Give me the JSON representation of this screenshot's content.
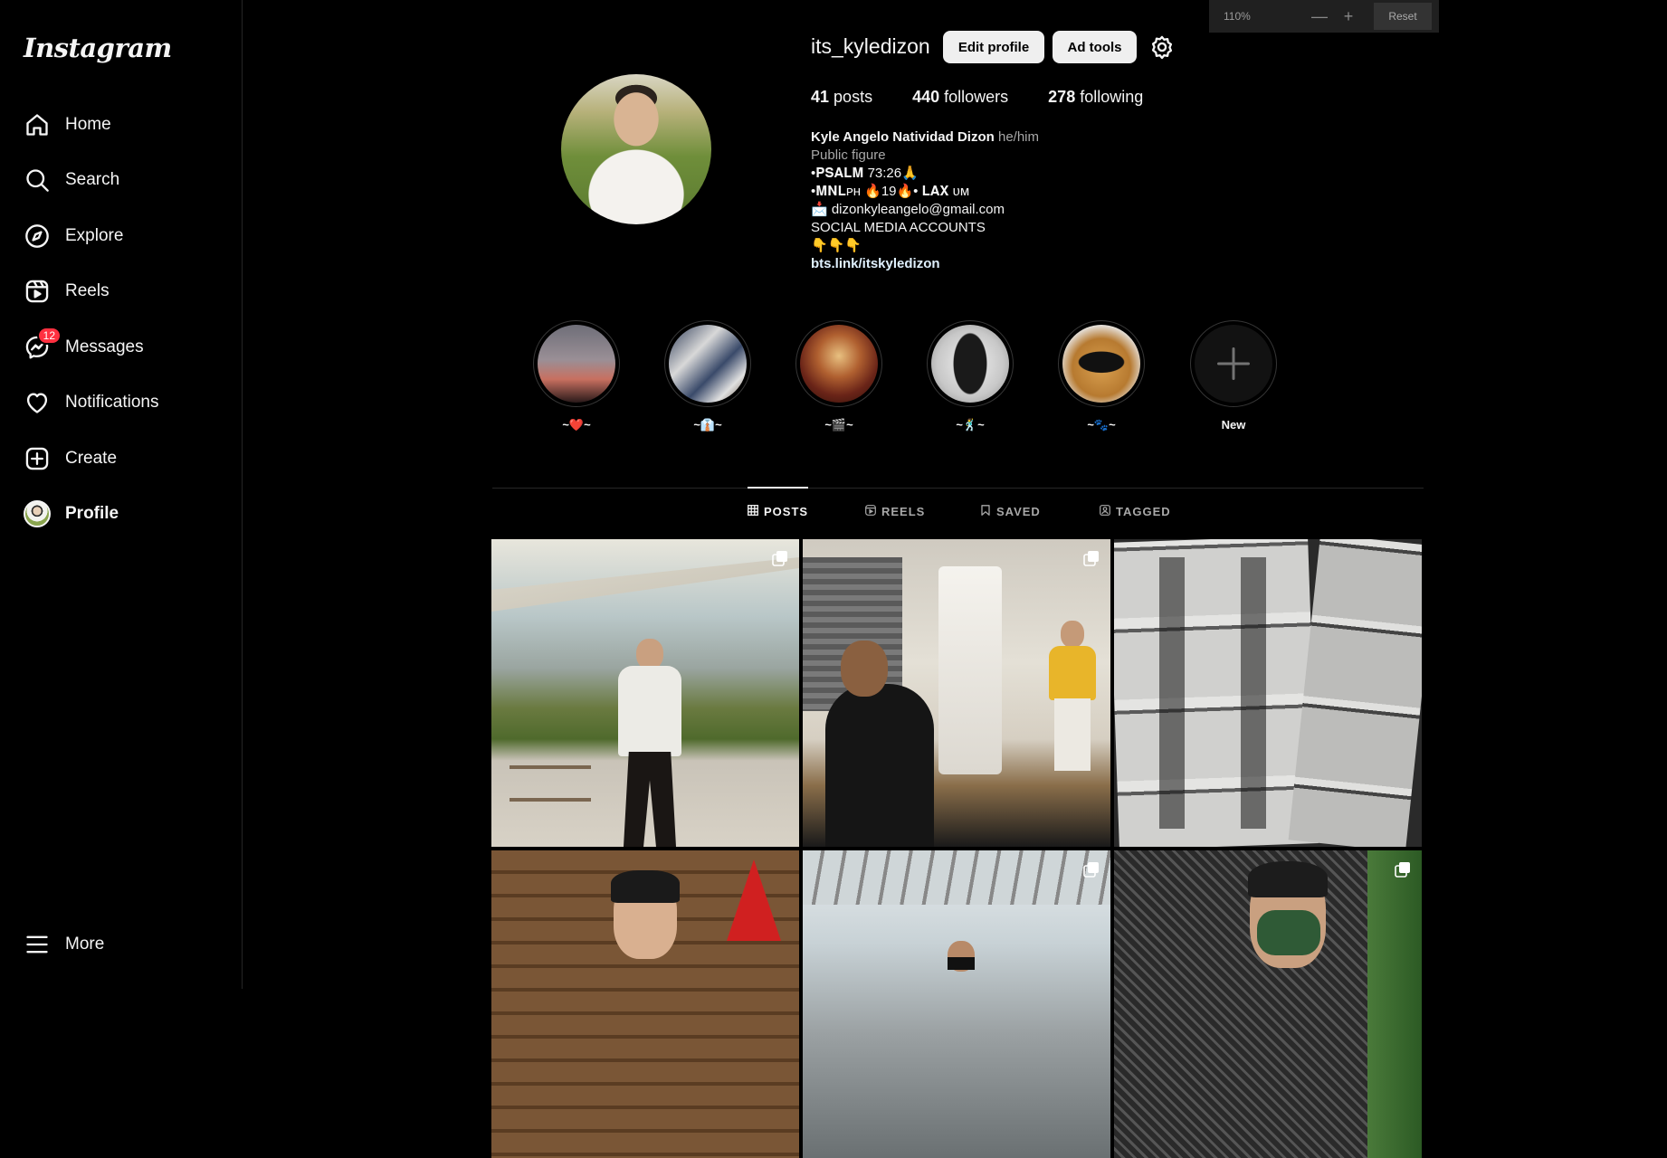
{
  "sidebar": {
    "logo": "Instagram",
    "items": [
      {
        "label": "Home",
        "icon": "home-icon"
      },
      {
        "label": "Search",
        "icon": "search-icon"
      },
      {
        "label": "Explore",
        "icon": "compass-icon"
      },
      {
        "label": "Reels",
        "icon": "reels-icon"
      },
      {
        "label": "Messages",
        "icon": "messenger-icon",
        "badge": "12"
      },
      {
        "label": "Notifications",
        "icon": "heart-icon"
      },
      {
        "label": "Create",
        "icon": "plus-square-icon"
      },
      {
        "label": "Profile",
        "icon": "avatar"
      }
    ],
    "more_label": "More"
  },
  "zoom": {
    "value": "110%",
    "minus": "—",
    "plus": "+",
    "reset": "Reset"
  },
  "profile": {
    "username": "its_kyledizon",
    "edit_label": "Edit profile",
    "adtools_label": "Ad tools",
    "stats": {
      "posts_count": "41",
      "posts_label": "posts",
      "followers_count": "440",
      "followers_label": "followers",
      "following_count": "278",
      "following_label": "following"
    },
    "bio": {
      "name": "Kyle Angelo Natividad Dizon",
      "pronouns": "he/him",
      "category": "Public figure",
      "lines": [
        "•𝐏𝐒𝐀𝐋𝐌 73:26🙏",
        "•𝐌𝐍𝐋ᴘʜ 🔥19🔥• 𝐋𝐀𝐗 ᴜᴍ",
        "📩 dizonkyleangelo@gmail.com",
        "SOCIAL MEDIA ACCOUNTS",
        "👇👇👇"
      ],
      "link": "bts.link/itskyledizon"
    }
  },
  "highlights": [
    {
      "label": "~❤️~"
    },
    {
      "label": "~👔~"
    },
    {
      "label": "~🎬~"
    },
    {
      "label": "~🕺~"
    },
    {
      "label": "~🐾~"
    },
    {
      "label": "New"
    }
  ],
  "tabs": [
    {
      "label": "POSTS",
      "icon": "grid-icon",
      "active": true
    },
    {
      "label": "REELS",
      "icon": "reels-icon",
      "active": false
    },
    {
      "label": "SAVED",
      "icon": "bookmark-icon",
      "active": false
    },
    {
      "label": "TAGGED",
      "icon": "tag-icon",
      "active": false
    }
  ],
  "colors": {
    "background": "#000000",
    "text": "#f5f5f5",
    "muted": "#a8a8a8",
    "badge": "#ff3040",
    "link": "#e0f1ff"
  }
}
